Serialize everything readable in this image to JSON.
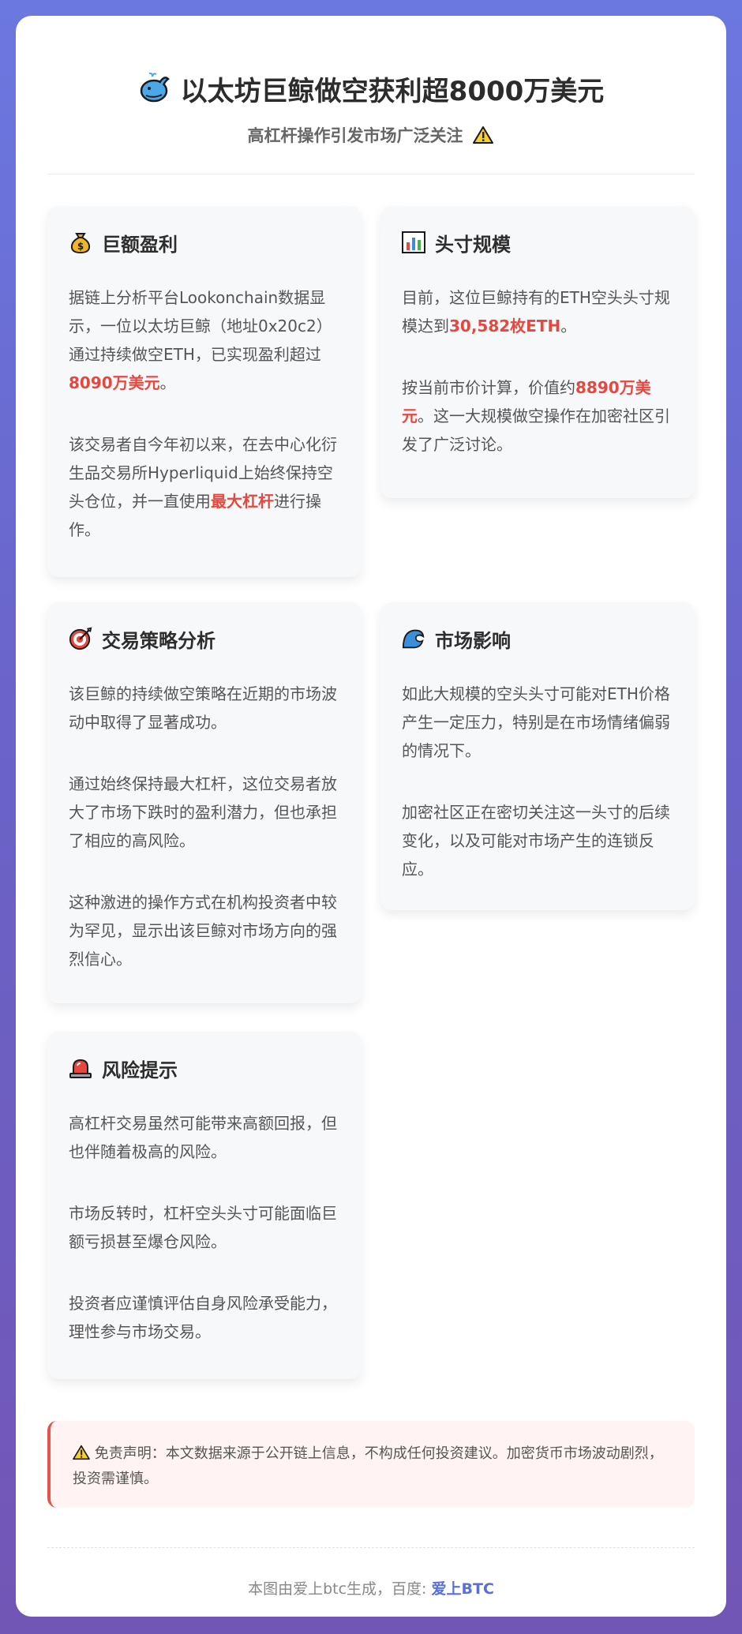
{
  "header": {
    "title_icon": "whale-icon",
    "title": "以太坊巨鲸做空获利超8000万美元",
    "subtitle": "高杠杆操作引发市场广泛关注",
    "subtitle_icon": "warning-icon"
  },
  "panels": {
    "profit": {
      "icon": "money-bag-icon",
      "title": "巨额盈利",
      "p1_text": "据链上分析平台Lookonchain数据显示，一位以太坊巨鲸（地址0x20c2）通过持续做空ETH，已实现盈利超过",
      "p1_highlight": "8090万美元",
      "p1_end": "。",
      "p2_text": "该交易者自今年初以来，在去中心化衍生品交易所Hyperliquid上始终保持空头仓位，并一直使用",
      "p2_highlight": "最大杠杆",
      "p2_end": "进行操作。"
    },
    "position": {
      "icon": "bar-chart-icon",
      "title": "头寸规模",
      "p1_text": "目前，这位巨鲸持有的ETH空头头寸规模达到",
      "p1_highlight": "30,582枚ETH",
      "p1_end": "。",
      "p2_text": "按当前市价计算，价值约",
      "p2_highlight": "8890万美元",
      "p2_end": "。这一大规模做空操作在加密社区引发了广泛讨论。"
    },
    "strategy": {
      "icon": "target-icon",
      "title": "交易策略分析",
      "p1": "该巨鲸的持续做空策略在近期的市场波动中取得了显著成功。",
      "p2": "通过始终保持最大杠杆，这位交易者放大了市场下跌时的盈利潜力，但也承担了相应的高风险。",
      "p3": "这种激进的操作方式在机构投资者中较为罕见，显示出该巨鲸对市场方向的强烈信心。"
    },
    "impact": {
      "icon": "wave-icon",
      "title": "市场影响",
      "p1": "如此大规模的空头头寸可能对ETH价格产生一定压力，特别是在市场情绪偏弱的情况下。",
      "p2": "加密社区正在密切关注这一头寸的后续变化，以及可能对市场产生的连锁反应。"
    },
    "risk": {
      "icon": "siren-icon",
      "title": "风险提示",
      "p1": "高杠杆交易虽然可能带来高额回报，但也伴随着极高的风险。",
      "p2": "市场反转时，杠杆空头头寸可能面临巨额亏损甚至爆仓风险。",
      "p3": "投资者应谨慎评估自身风险承受能力，理性参与市场交易。"
    }
  },
  "disclaimer": {
    "icon": "warning-icon",
    "text": "免责声明：本文数据来源于公开链上信息，不构成任何投资建议。加密货币市场波动剧烈，投资需谨慎。"
  },
  "footer": {
    "text": "本图由爱上btc生成，百度: ",
    "brand": "爱上BTC"
  },
  "colors": {
    "highlight": "#e5483f",
    "brand": "#5b6fd6",
    "background_top": "#6b78e0",
    "background_bottom": "#7256b6"
  }
}
